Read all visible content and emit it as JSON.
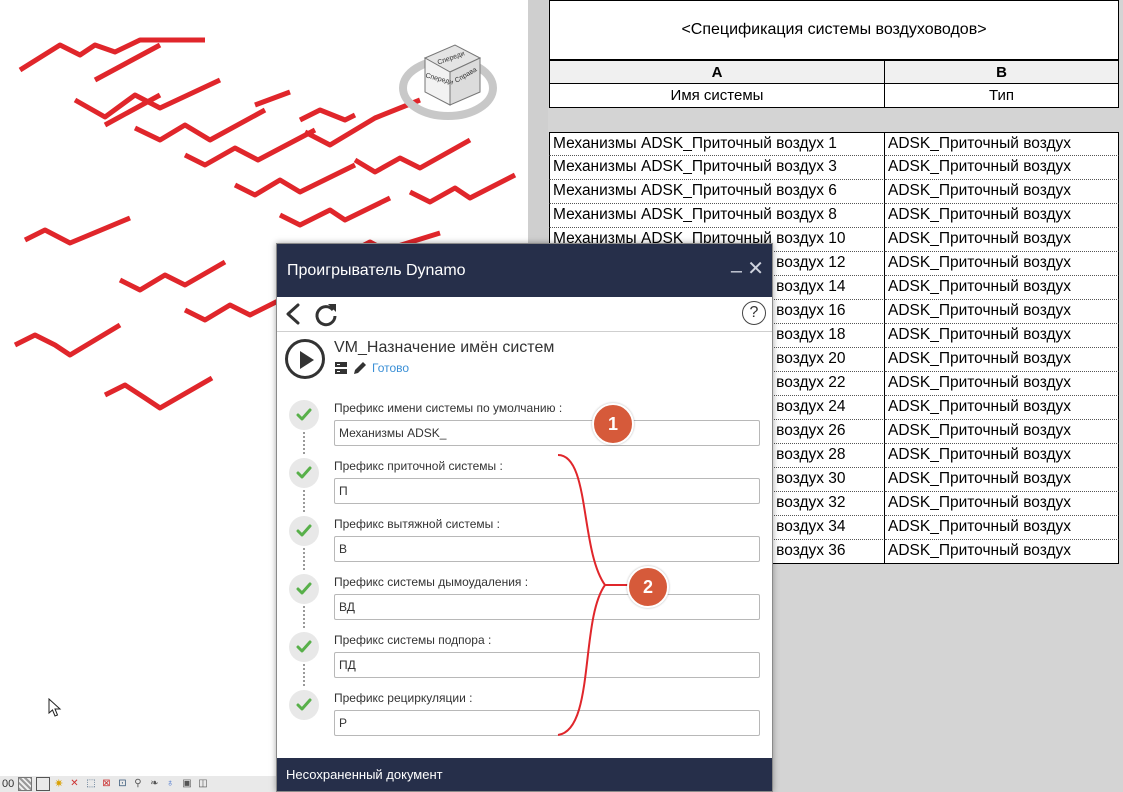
{
  "schedule": {
    "title": "<Спецификация системы воздуховодов>",
    "column_letters": [
      "A",
      "B"
    ],
    "column_names": [
      "Имя системы",
      "Тип"
    ],
    "rows": [
      [
        "Механизмы ADSK_Приточный воздух 1",
        "ADSK_Приточный воздух"
      ],
      [
        "Механизмы ADSK_Приточный воздух 3",
        "ADSK_Приточный воздух"
      ],
      [
        "Механизмы ADSK_Приточный воздух 6",
        "ADSK_Приточный воздух"
      ],
      [
        "Механизмы ADSK_Приточный воздух 8",
        "ADSK_Приточный воздух"
      ],
      [
        "Механизмы ADSK_Приточный воздух 10",
        "ADSK_Приточный воздух"
      ],
      [
        "Механизмы ADSK_Приточный воздух 12",
        "ADSK_Приточный воздух"
      ],
      [
        "Механизмы ADSK_Приточный воздух 14",
        "ADSK_Приточный воздух"
      ],
      [
        "Механизмы ADSK_Приточный воздух 16",
        "ADSK_Приточный воздух"
      ],
      [
        "Механизмы ADSK_Приточный воздух 18",
        "ADSK_Приточный воздух"
      ],
      [
        "Механизмы ADSK_Приточный воздух 20",
        "ADSK_Приточный воздух"
      ],
      [
        "Механизмы ADSK_Приточный воздух 22",
        "ADSK_Приточный воздух"
      ],
      [
        "Механизмы ADSK_Приточный воздух 24",
        "ADSK_Приточный воздух"
      ],
      [
        "Механизмы ADSK_Приточный воздух 26",
        "ADSK_Приточный воздух"
      ],
      [
        "Механизмы ADSK_Приточный воздух 28",
        "ADSK_Приточный воздух"
      ],
      [
        "Механизмы ADSK_Приточный воздух 30",
        "ADSK_Приточный воздух"
      ],
      [
        "Механизмы ADSK_Приточный воздух 32",
        "ADSK_Приточный воздух"
      ],
      [
        "Механизмы ADSK_Приточный воздух 34",
        "ADSK_Приточный воздух"
      ],
      [
        "Механизмы ADSK_Приточный воздух 36",
        "ADSK_Приточный воздух"
      ]
    ]
  },
  "viewcube": {
    "face_front": "Спереди",
    "face_right": "Справа",
    "face_left": "Спереди"
  },
  "statusbar": {
    "scale_text": "00"
  },
  "dynamo": {
    "window_title": "Проигрыватель Dynamo",
    "script_name": "VM_Назначение имён систем",
    "script_status": "Готово",
    "footer": "Несохраненный документ",
    "help_label": "?",
    "fields": [
      {
        "label": "Префикс имени системы по умолчанию :",
        "value": "Механизмы ADSK_"
      },
      {
        "label": "Префикс приточной системы :",
        "value": "П"
      },
      {
        "label": "Префикс вытяжной системы :",
        "value": "В"
      },
      {
        "label": "Префикс системы дымоудаления :",
        "value": "ВД"
      },
      {
        "label": "Префикс системы подпора :",
        "value": "ПД"
      },
      {
        "label": "Префикс рециркуляции :",
        "value": "Р"
      }
    ]
  },
  "annotations": {
    "badge_1": "1",
    "badge_2": "2"
  },
  "colors": {
    "duct": "#e0262b",
    "dynamo_header": "#262f4a",
    "badge": "#d65a3a",
    "check": "#58b04a",
    "status": "#3a8fd6"
  }
}
